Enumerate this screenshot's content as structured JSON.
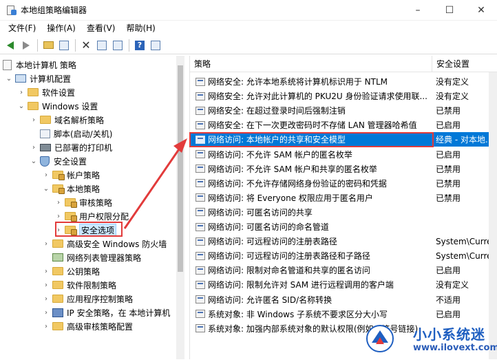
{
  "window": {
    "title": "本地组策略编辑器",
    "min": "–",
    "max": "☐",
    "close": "✕"
  },
  "menu": [
    "文件(F)",
    "操作(A)",
    "查看(V)",
    "帮助(H)"
  ],
  "tree": {
    "root": "本地计算机 策略",
    "computer_config": "计算机配置",
    "software_settings": "软件设置",
    "windows_settings": "Windows 设置",
    "dns_policy": "域名解析策略",
    "scripts": "脚本(启动/关机)",
    "printers": "已部署的打印机",
    "security_settings": "安全设置",
    "account_policy": "帐户策略",
    "local_policy": "本地策略",
    "audit_policy": "审核策略",
    "user_rights": "用户权限分配",
    "security_options": "安全选项",
    "firewall": "高级安全 Windows 防火墙",
    "network_list": "网络列表管理器策略",
    "public_key": "公钥策略",
    "software_restriction": "软件限制策略",
    "app_control": "应用程序控制策略",
    "ipsec": "IP 安全策略，在 本地计算机",
    "advanced_audit": "高级审核策略配置"
  },
  "list": {
    "col_policy": "策略",
    "col_setting": "安全设置",
    "rows": [
      {
        "name": "网络安全: 允许本地系统将计算机标识用于 NTLM",
        "value": "没有定义"
      },
      {
        "name": "网络安全: 允许对此计算机的 PKU2U 身份验证请求使用联...",
        "value": "没有定义"
      },
      {
        "name": "网络安全: 在超过登录时间后强制注销",
        "value": "已禁用"
      },
      {
        "name": "网络安全: 在下一次更改密码时不存储 LAN 管理器哈希值",
        "value": "已启用"
      },
      {
        "name": "网络访问: 本地帐户的共享和安全模型",
        "value": "经典 - 对本地..."
      },
      {
        "name": "网络访问: 不允许 SAM 帐户的匿名枚举",
        "value": "已启用"
      },
      {
        "name": "网络访问: 不允许 SAM 帐户和共享的匿名枚举",
        "value": "已禁用"
      },
      {
        "name": "网络访问: 不允许存储网络身份验证的密码和凭据",
        "value": "已禁用"
      },
      {
        "name": "网络访问: 将 Everyone 权限应用于匿名用户",
        "value": "已禁用"
      },
      {
        "name": "网络访问: 可匿名访问的共享",
        "value": ""
      },
      {
        "name": "网络访问: 可匿名访问的命名管道",
        "value": ""
      },
      {
        "name": "网络访问: 可远程访问的注册表路径",
        "value": "System\\CurrentC..."
      },
      {
        "name": "网络访问: 可远程访问的注册表路径和子路径",
        "value": "System\\CurrentC..."
      },
      {
        "name": "网络访问: 限制对命名管道和共享的匿名访问",
        "value": "已启用"
      },
      {
        "name": "网络访问: 限制允许对 SAM 进行远程调用的客户端",
        "value": "没有定义"
      },
      {
        "name": "网络访问: 允许匿名 SID/名称转换",
        "value": "不适用"
      },
      {
        "name": "系统对象: 非 Windows 子系统不要求区分大小写",
        "value": "已启用"
      },
      {
        "name": "系统对象: 加强内部系统对象的默认权限(例如，符号链接)",
        "value": ""
      }
    ]
  },
  "watermark": {
    "name": "小小系统迷",
    "url": "www.ilovext.com"
  },
  "colors": {
    "selection": "#0078d7",
    "annotation": "#e23b3b"
  }
}
